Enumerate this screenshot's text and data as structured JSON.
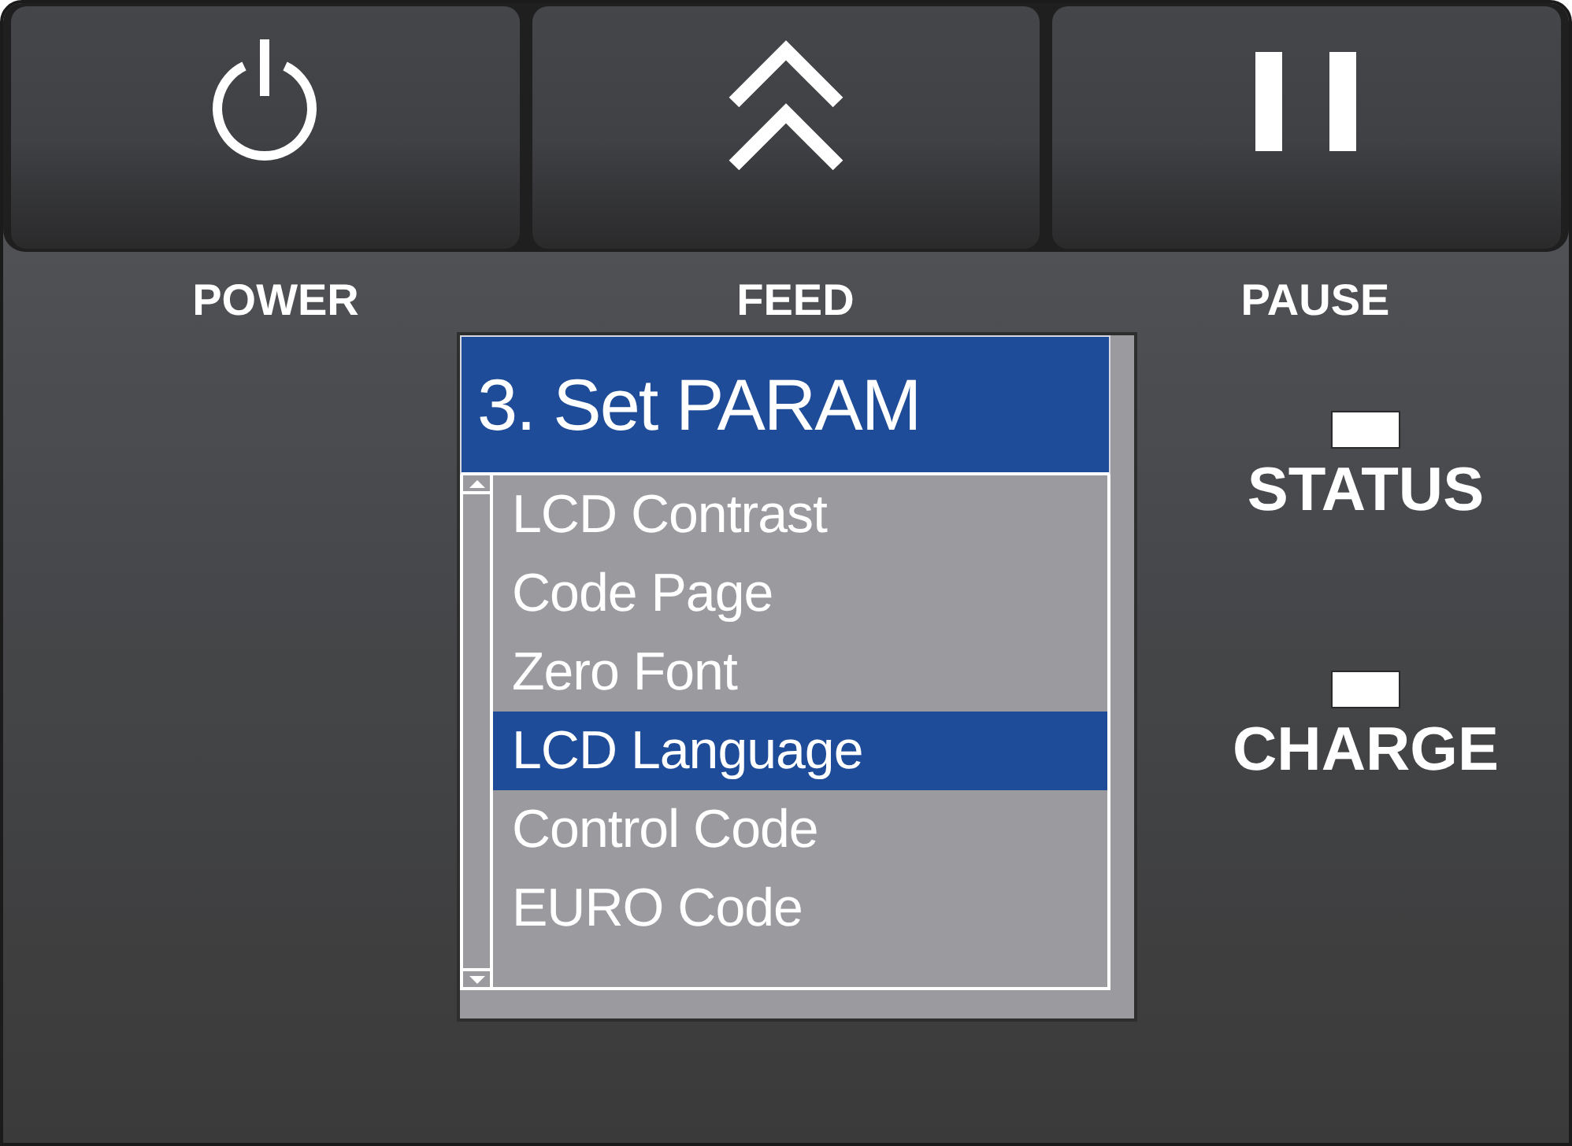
{
  "buttons": [
    {
      "kind": "power",
      "label": "POWER"
    },
    {
      "kind": "feed",
      "label": "FEED"
    },
    {
      "kind": "pause",
      "label": "PAUSE"
    }
  ],
  "screen": {
    "title": "3. Set PARAM",
    "items": [
      {
        "label": "LCD Contrast",
        "selected": false
      },
      {
        "label": "Code Page",
        "selected": false
      },
      {
        "label": "Zero Font",
        "selected": false
      },
      {
        "label": "LCD Language",
        "selected": true
      },
      {
        "label": "Control Code",
        "selected": false
      },
      {
        "label": "EURO Code",
        "selected": false
      }
    ]
  },
  "indicators": [
    {
      "label": "STATUS"
    },
    {
      "label": "CHARGE"
    }
  ]
}
